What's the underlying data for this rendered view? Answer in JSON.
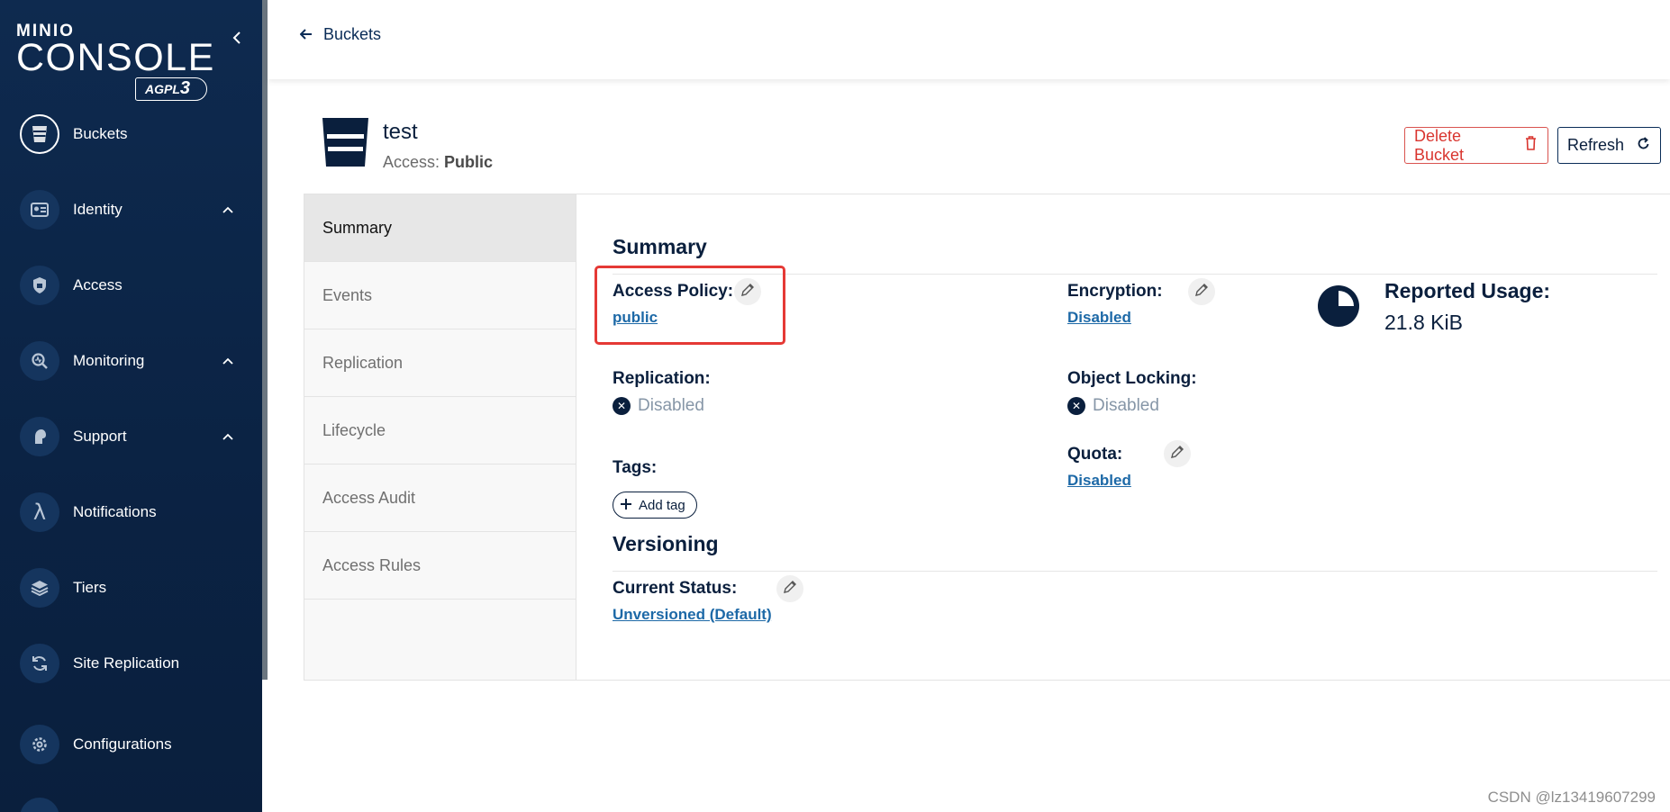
{
  "sidebar": {
    "logo": {
      "line1": "MINIO",
      "line2": "CONSOLE",
      "badge": "AGPLv3"
    },
    "collapse_icon": "chevron-left-icon",
    "items": [
      {
        "label": "Buckets",
        "icon": "bucket-icon",
        "active": true,
        "expandable": false
      },
      {
        "label": "Identity",
        "icon": "id-card-icon",
        "active": false,
        "expandable": true
      },
      {
        "label": "Access",
        "icon": "lock-icon",
        "active": false,
        "expandable": false
      },
      {
        "label": "Monitoring",
        "icon": "monitor-icon",
        "active": false,
        "expandable": true
      },
      {
        "label": "Support",
        "icon": "support-icon",
        "active": false,
        "expandable": true
      },
      {
        "label": "Notifications",
        "icon": "lambda-icon",
        "active": false,
        "expandable": false
      },
      {
        "label": "Tiers",
        "icon": "layers-icon",
        "active": false,
        "expandable": false
      },
      {
        "label": "Site Replication",
        "icon": "sync-icon",
        "active": false,
        "expandable": false
      },
      {
        "label": "Configurations",
        "icon": "gear-icon",
        "active": false,
        "expandable": false
      }
    ]
  },
  "topbar": {
    "back_label": "Buckets"
  },
  "bucket": {
    "name": "test",
    "access_prefix": "Access:",
    "access_value": "Public",
    "delete_label": "Delete Bucket",
    "refresh_label": "Refresh"
  },
  "tabs": [
    "Summary",
    "Events",
    "Replication",
    "Lifecycle",
    "Access Audit",
    "Access Rules"
  ],
  "summary": {
    "title": "Summary",
    "access_policy_label": "Access Policy:",
    "access_policy_value": "public",
    "encryption_label": "Encryption:",
    "encryption_value": "Disabled",
    "replication_label": "Replication:",
    "replication_value": "Disabled",
    "object_locking_label": "Object Locking:",
    "object_locking_value": "Disabled",
    "tags_label": "Tags:",
    "add_tag_label": "Add tag",
    "quota_label": "Quota:",
    "quota_value": "Disabled",
    "usage_label": "Reported Usage:",
    "usage_value": "21.8 KiB",
    "usage_fraction": 0.25
  },
  "versioning": {
    "title": "Versioning",
    "status_label": "Current Status:",
    "status_value": "Unversioned (Default)"
  },
  "watermark": "CSDN @lz13419607299",
  "colors": {
    "sidebar": "#0e2a4f",
    "accent": "#0a1f3d",
    "link": "#1d69a7",
    "danger": "#d9352f",
    "highlight": "#e53935"
  }
}
